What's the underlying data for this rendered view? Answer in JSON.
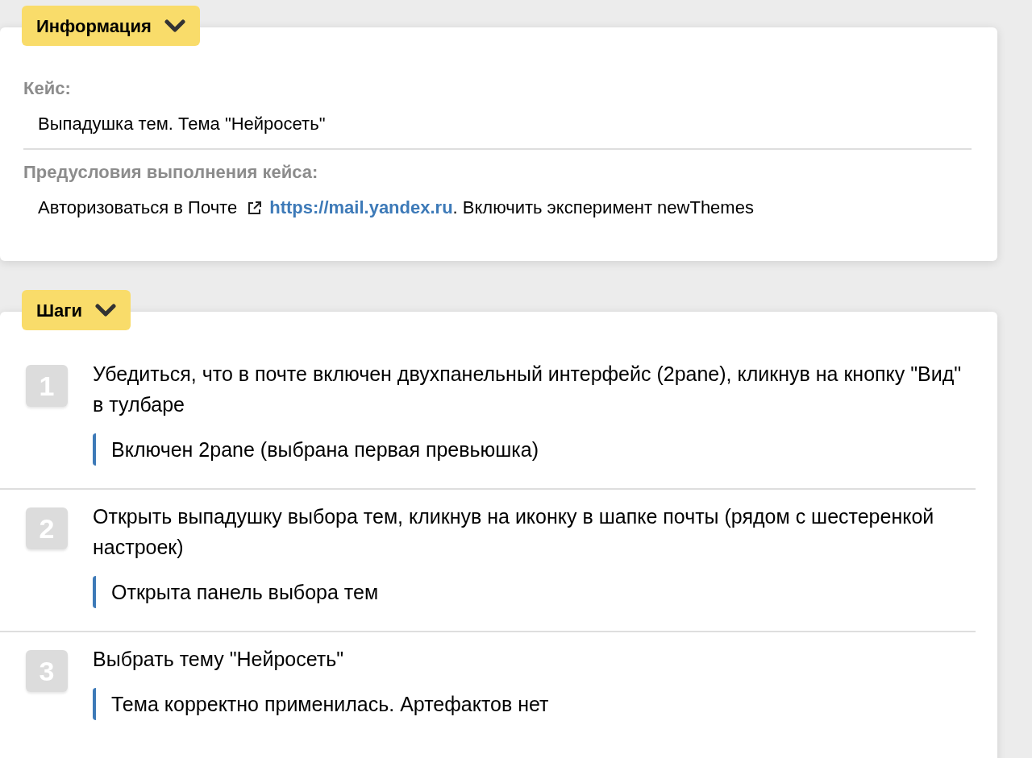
{
  "info_section": {
    "title": "Информация",
    "expanded": true,
    "fields": [
      {
        "label": "Кейс:",
        "value": "Выпадушка тем. Тема \"Нейросеть\""
      },
      {
        "label": "Предусловия выполнения кейса:",
        "before": "Авторизоваться в Почте",
        "link": "https://mail.yandex.ru",
        "after": ". Включить эксперимент newThemes"
      }
    ]
  },
  "steps_section": {
    "title": "Шаги",
    "expanded": true,
    "steps": [
      {
        "number": "1",
        "action": "Убедиться, что в почте включен двухпанельный интерфейс (2pane), кликнув на кнопку \"Вид\" в тулбаре",
        "expected": "Включен 2pane (выбрана первая превьюшка)"
      },
      {
        "number": "2",
        "action": "Открыть выпадушку выбора тем, кликнув на иконку в шапке почты (рядом с шестеренкой настроек)",
        "expected": "Открыта панель выбора тем"
      },
      {
        "number": "3",
        "action": "Выбрать тему \"Нейросеть\"",
        "expected": "Тема корректно применилась. Артефактов нет"
      }
    ]
  }
}
